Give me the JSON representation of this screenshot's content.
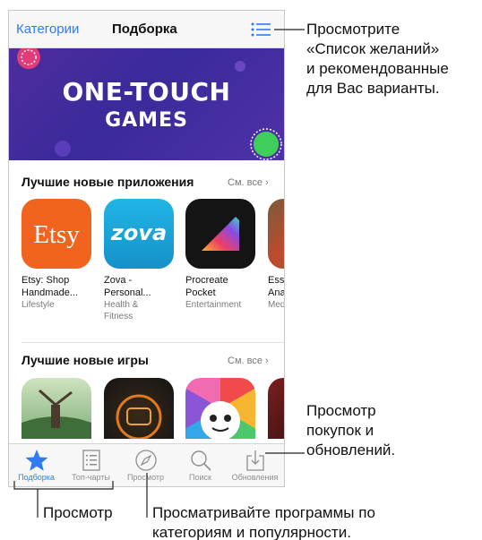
{
  "navbar": {
    "left_label": "Категории",
    "title": "Подборка",
    "list_icon": "list-icon"
  },
  "banner": {
    "line1": "ONE-TOUCH",
    "line2": "GAMES"
  },
  "section_apps": {
    "title": "Лучшие новые приложения",
    "see_all": "См. все",
    "apps": [
      {
        "name1": "Etsy: Shop",
        "name2": "Handmade...",
        "category": "Lifestyle",
        "category2": "",
        "icon_text": "Etsy"
      },
      {
        "name1": "Zova -",
        "name2": "Personal...",
        "category": "Health &",
        "category2": "Fitness",
        "icon_text": "zova"
      },
      {
        "name1": "Procreate",
        "name2": "Pocket",
        "category": "Entertainment",
        "category2": ""
      },
      {
        "name1": "Esse",
        "name2": "Ana",
        "category": "Med",
        "category2": ""
      }
    ]
  },
  "section_games": {
    "title": "Лучшие новые игры",
    "see_all": "См. все"
  },
  "tabbar": {
    "tabs": [
      {
        "label": "Подборка",
        "icon": "star-icon"
      },
      {
        "label": "Топ-чарты",
        "icon": "top-charts-icon"
      },
      {
        "label": "Просмотр",
        "icon": "compass-icon"
      },
      {
        "label": "Поиск",
        "icon": "search-icon"
      },
      {
        "label": "Обновления",
        "icon": "updates-icon"
      }
    ]
  },
  "callouts": {
    "wishlist": [
      "Просмотрите",
      "«Список желаний»",
      "и рекомендованные",
      "для Вас варианты."
    ],
    "purchases": [
      "Просмотр",
      "покупок и",
      "обновлений."
    ],
    "browse": [
      "Просмотр"
    ],
    "categories": [
      "Просматривайте программы по",
      "категориям и популярности."
    ]
  },
  "colors": {
    "accent": "#2f7bf6",
    "banner": "#4a2da0",
    "etsy": "#f1641e",
    "zova": "#1aa6d8"
  }
}
